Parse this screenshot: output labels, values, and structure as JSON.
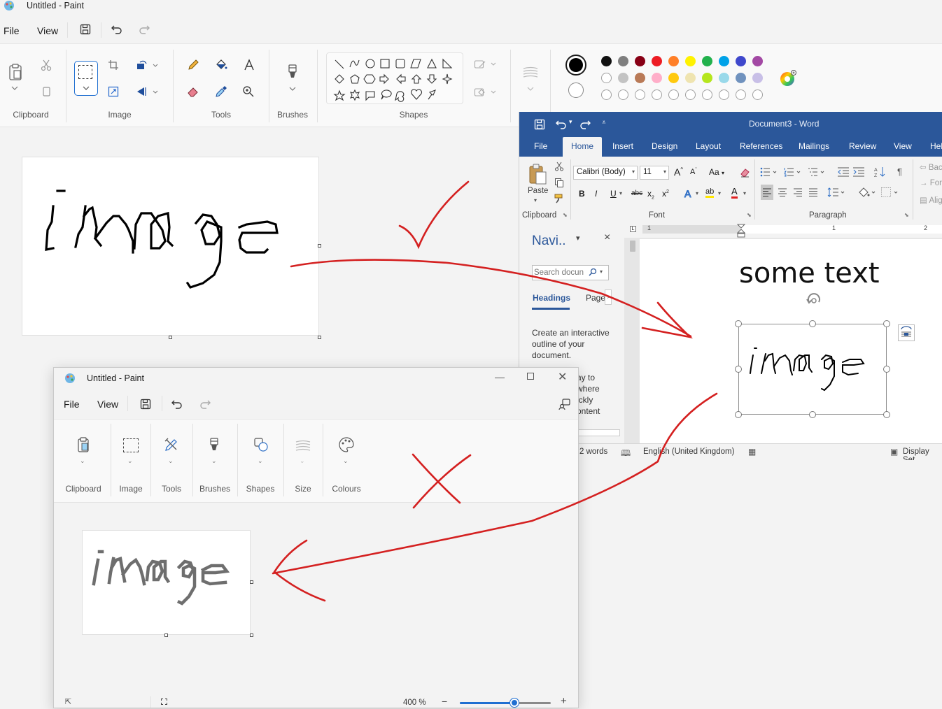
{
  "paint_main": {
    "title": "Untitled - Paint",
    "menu": {
      "file": "File",
      "view": "View"
    },
    "groups": {
      "clipboard": "Clipboard",
      "image": "Image",
      "tools": "Tools",
      "brushes": "Brushes",
      "shapes": "Shapes"
    },
    "palette": {
      "row1": [
        "#111111",
        "#7f7f7f",
        "#880015",
        "#ed1c24",
        "#ff7f27",
        "#fff200",
        "#22b14c",
        "#00a2e8",
        "#3f48cc",
        "#a349a4"
      ],
      "row2": [
        "#ffffff",
        "#c3c3c3",
        "#b97a57",
        "#ffaec9",
        "#ffc90e",
        "#efe4b0",
        "#b5e61d",
        "#99d9ea",
        "#7092be",
        "#c8bfe7"
      ],
      "active_color_1": "#000000",
      "active_color_2": "#ffffff"
    },
    "canvas_text": "Image"
  },
  "word": {
    "title": "Document3 - Word",
    "tabs": [
      "File",
      "Home",
      "Insert",
      "Design",
      "Layout",
      "References",
      "Mailings",
      "Review",
      "View",
      "Hel"
    ],
    "active_tab": "Home",
    "clipboard": {
      "paste": "Paste",
      "label": "Clipboard"
    },
    "font": {
      "name": "Calibri (Body)",
      "size": "11",
      "label": "Font",
      "grow": "A",
      "shrink": "A",
      "change_case": "Aa",
      "bold": "B",
      "italic": "I",
      "underline": "U",
      "strikethrough": "abc",
      "subscript": "x",
      "subscript_mark": "2",
      "superscript": "x",
      "superscript_mark": "2",
      "text_effects": "A",
      "highlight": "ab",
      "font_color": "A"
    },
    "paragraph": {
      "label": "Paragraph",
      "pilcrow": "¶"
    },
    "styles_partial": [
      "Bac",
      "For",
      "Alig"
    ],
    "nav": {
      "title": "Navi..",
      "search_placeholder": "Search docun",
      "tab_headings": "Headings",
      "tab_pages": "Page",
      "body": "Create an interactive outline of your document.",
      "body2": [
        "ay to",
        "where",
        "ickly",
        "ontent"
      ]
    },
    "ruler": {
      "mark1": "1",
      "mark_left": "1",
      "mark2": "2"
    },
    "document_text": "some text",
    "image_text": "image",
    "status": {
      "words": "2 words",
      "language": "English (United Kingdom)",
      "display": "Display Set"
    }
  },
  "paint_small": {
    "title": "Untitled - Paint",
    "menu": {
      "file": "File",
      "view": "View"
    },
    "groups": [
      "Clipboard",
      "Image",
      "Tools",
      "Brushes",
      "Shapes",
      "Size",
      "Colours"
    ],
    "canvas_text": "image",
    "zoom": "400 %",
    "zoom_fraction": 0.6
  }
}
